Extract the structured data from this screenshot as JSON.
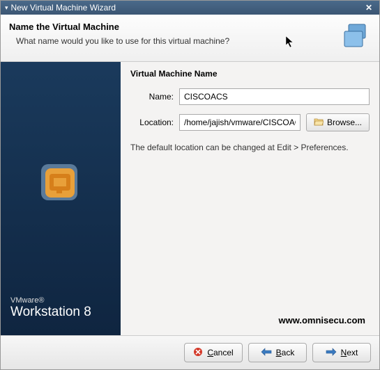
{
  "titlebar": {
    "title": "New Virtual Machine Wizard"
  },
  "header": {
    "heading": "Name the Virtual Machine",
    "subheading": "What name would you like to use for this virtual machine?"
  },
  "sidebar": {
    "brand": "VMware®",
    "product": "Workstation 8"
  },
  "main": {
    "section_title": "Virtual Machine Name",
    "name_label": "Name:",
    "name_value": "CISCOACS",
    "location_label": "Location:",
    "location_value": "/home/jajish/vmware/CISCOACS",
    "browse_label": "Browse...",
    "hint": "The default location can be changed at Edit > Preferences."
  },
  "watermark": "www.omnisecu.com",
  "footer": {
    "cancel": "Cancel",
    "back": "Back",
    "next": "Next"
  }
}
